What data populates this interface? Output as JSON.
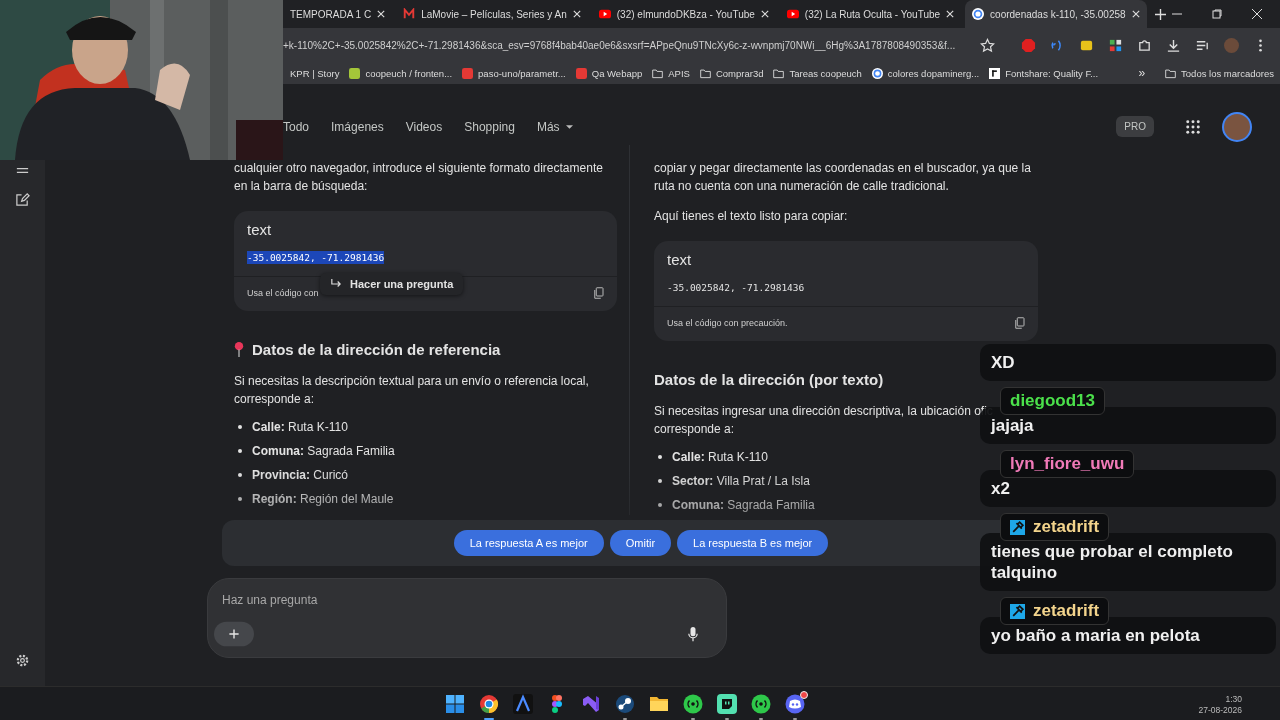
{
  "browser": {
    "tabs": [
      {
        "title": "TEMPORADA 1 C",
        "kind": "none",
        "selected": false
      },
      {
        "title": "LaMovie – Películas, Series y An",
        "kind": "m",
        "selected": false
      },
      {
        "title": "(32) elmundoDKBza - YouTube",
        "kind": "play",
        "selected": false
      },
      {
        "title": "(32) La Ruta Oculta - YouTube",
        "kind": "play",
        "selected": false
      },
      {
        "title": "coordenadas k-110, -35.00258",
        "kind": "g",
        "selected": true
      }
    ],
    "url": "+k-110%2C+-35.0025842%2C+-71.2981436&sca_esv=9768f4bab40ae0e6&sxsrf=APpeQnu9TNcXy6c-z-wvnpmj70NWi__6Hg%3A1787808490353&f...",
    "bookmarks": [
      {
        "label": "KPR | Story",
        "kind": "none"
      },
      {
        "label": "coopeuch / fronten...",
        "kind": "site",
        "color": "#a4c639"
      },
      {
        "label": "paso-uno/parametr...",
        "kind": "site",
        "color": "#e53935"
      },
      {
        "label": "Qa Webapp",
        "kind": "site",
        "color": "#e53935"
      },
      {
        "label": "APIS",
        "kind": "folder"
      },
      {
        "label": "Comprar3d",
        "kind": "folder"
      },
      {
        "label": "Tareas coopeuch",
        "kind": "folder"
      },
      {
        "label": "colores dopaminerg...",
        "kind": "g"
      },
      {
        "label": "Fontshare: Quality F...",
        "kind": "square"
      }
    ],
    "more": "»",
    "all_bookmarks": "Todos los marcadores"
  },
  "search_tabs": [
    {
      "label": "Todo",
      "selected": false
    },
    {
      "label": "Imágenes",
      "selected": false
    },
    {
      "label": "Videos",
      "selected": false
    },
    {
      "label": "Shopping",
      "selected": false
    },
    {
      "label": "Más",
      "selected": false,
      "menu": true
    }
  ],
  "pro_badge": "PRO",
  "answers": [
    {
      "intro": [
        "cualquier otro navegador, introduce el siguiente formato directamente en la barra de búsqueda:"
      ],
      "code": {
        "lang": "text",
        "value": "-35.0025842, -71.2981436",
        "selected": true,
        "footer": "Usa el código con",
        "tooltip": "Hacer una pregunta"
      },
      "heading": "Datos de la dirección de referencia",
      "pin": true,
      "paragraph": "Si necesitas la descripción textual para un envío o referencia local, corresponde a:",
      "items": [
        {
          "label": "Calle:",
          "value": "Ruta K-110"
        },
        {
          "label": "Comuna:",
          "value": "Sagrada Familia"
        },
        {
          "label": "Provincia:",
          "value": "Curicó"
        },
        {
          "label": "Región:",
          "value": "Región del Maule"
        }
      ]
    },
    {
      "intro": [
        "copiar y pegar directamente las coordenadas en el buscador, ya que la ruta no cuenta con una numeración de calle tradicional.",
        "Aquí tienes el texto listo para copiar:"
      ],
      "code": {
        "lang": "text",
        "value": "-35.0025842, -71.2981436",
        "selected": false,
        "footer": "Usa el código con precaución."
      },
      "heading": "Datos de la dirección (por texto)",
      "pin": false,
      "paragraph": "Si necesitas ingresar una dirección descriptiva, la ubicación ofic",
      "items": [
        {
          "label": "Calle:",
          "value": "Ruta K-110"
        },
        {
          "label": "Sector:",
          "value": "Villa Prat / La Isla"
        },
        {
          "label": "Comuna:",
          "value": "Sagrada Familia"
        }
      ]
    }
  ],
  "paragraph_end": "corresponde a:",
  "compare_buttons": [
    "La respuesta A es mejor",
    "Omitir",
    "La respuesta B es mejor"
  ],
  "ask": {
    "placeholder": "Haz una pregunta"
  },
  "chat": [
    {
      "text": "XD"
    },
    {
      "user": "diegood13",
      "color": "#4be04b",
      "badge": false,
      "text": "jajaja"
    },
    {
      "user": "lyn_fiore_uwu",
      "color": "#f07ab8",
      "badge": false,
      "text": "x2"
    },
    {
      "user": "zetadrift",
      "color": "#f3d48c",
      "badge": true,
      "text": "tienes que probar el completo talquino"
    },
    {
      "user": "zetadrift",
      "color": "#f3d48c",
      "badge": true,
      "text": "yo baño a maria en pelota"
    }
  ],
  "clock": {
    "time": "1:30",
    "date": "27-08-2026"
  },
  "taskbar": [
    {
      "kind": "start",
      "active": false,
      "running": false
    },
    {
      "kind": "browser",
      "active": true,
      "running": true
    },
    {
      "kind": "a",
      "active": false,
      "running": false
    },
    {
      "kind": "shapes",
      "active": false,
      "running": false
    },
    {
      "kind": "ribbon",
      "active": false,
      "running": false
    },
    {
      "kind": "disc",
      "active": false,
      "running": true
    },
    {
      "kind": "folder",
      "active": false,
      "running": false
    },
    {
      "kind": "signal",
      "active": false,
      "running": true
    },
    {
      "kind": "bubble",
      "active": false,
      "running": true
    },
    {
      "kind": "signal",
      "active": false,
      "running": true
    },
    {
      "kind": "discord",
      "active": false,
      "running": true,
      "badge": true
    }
  ]
}
